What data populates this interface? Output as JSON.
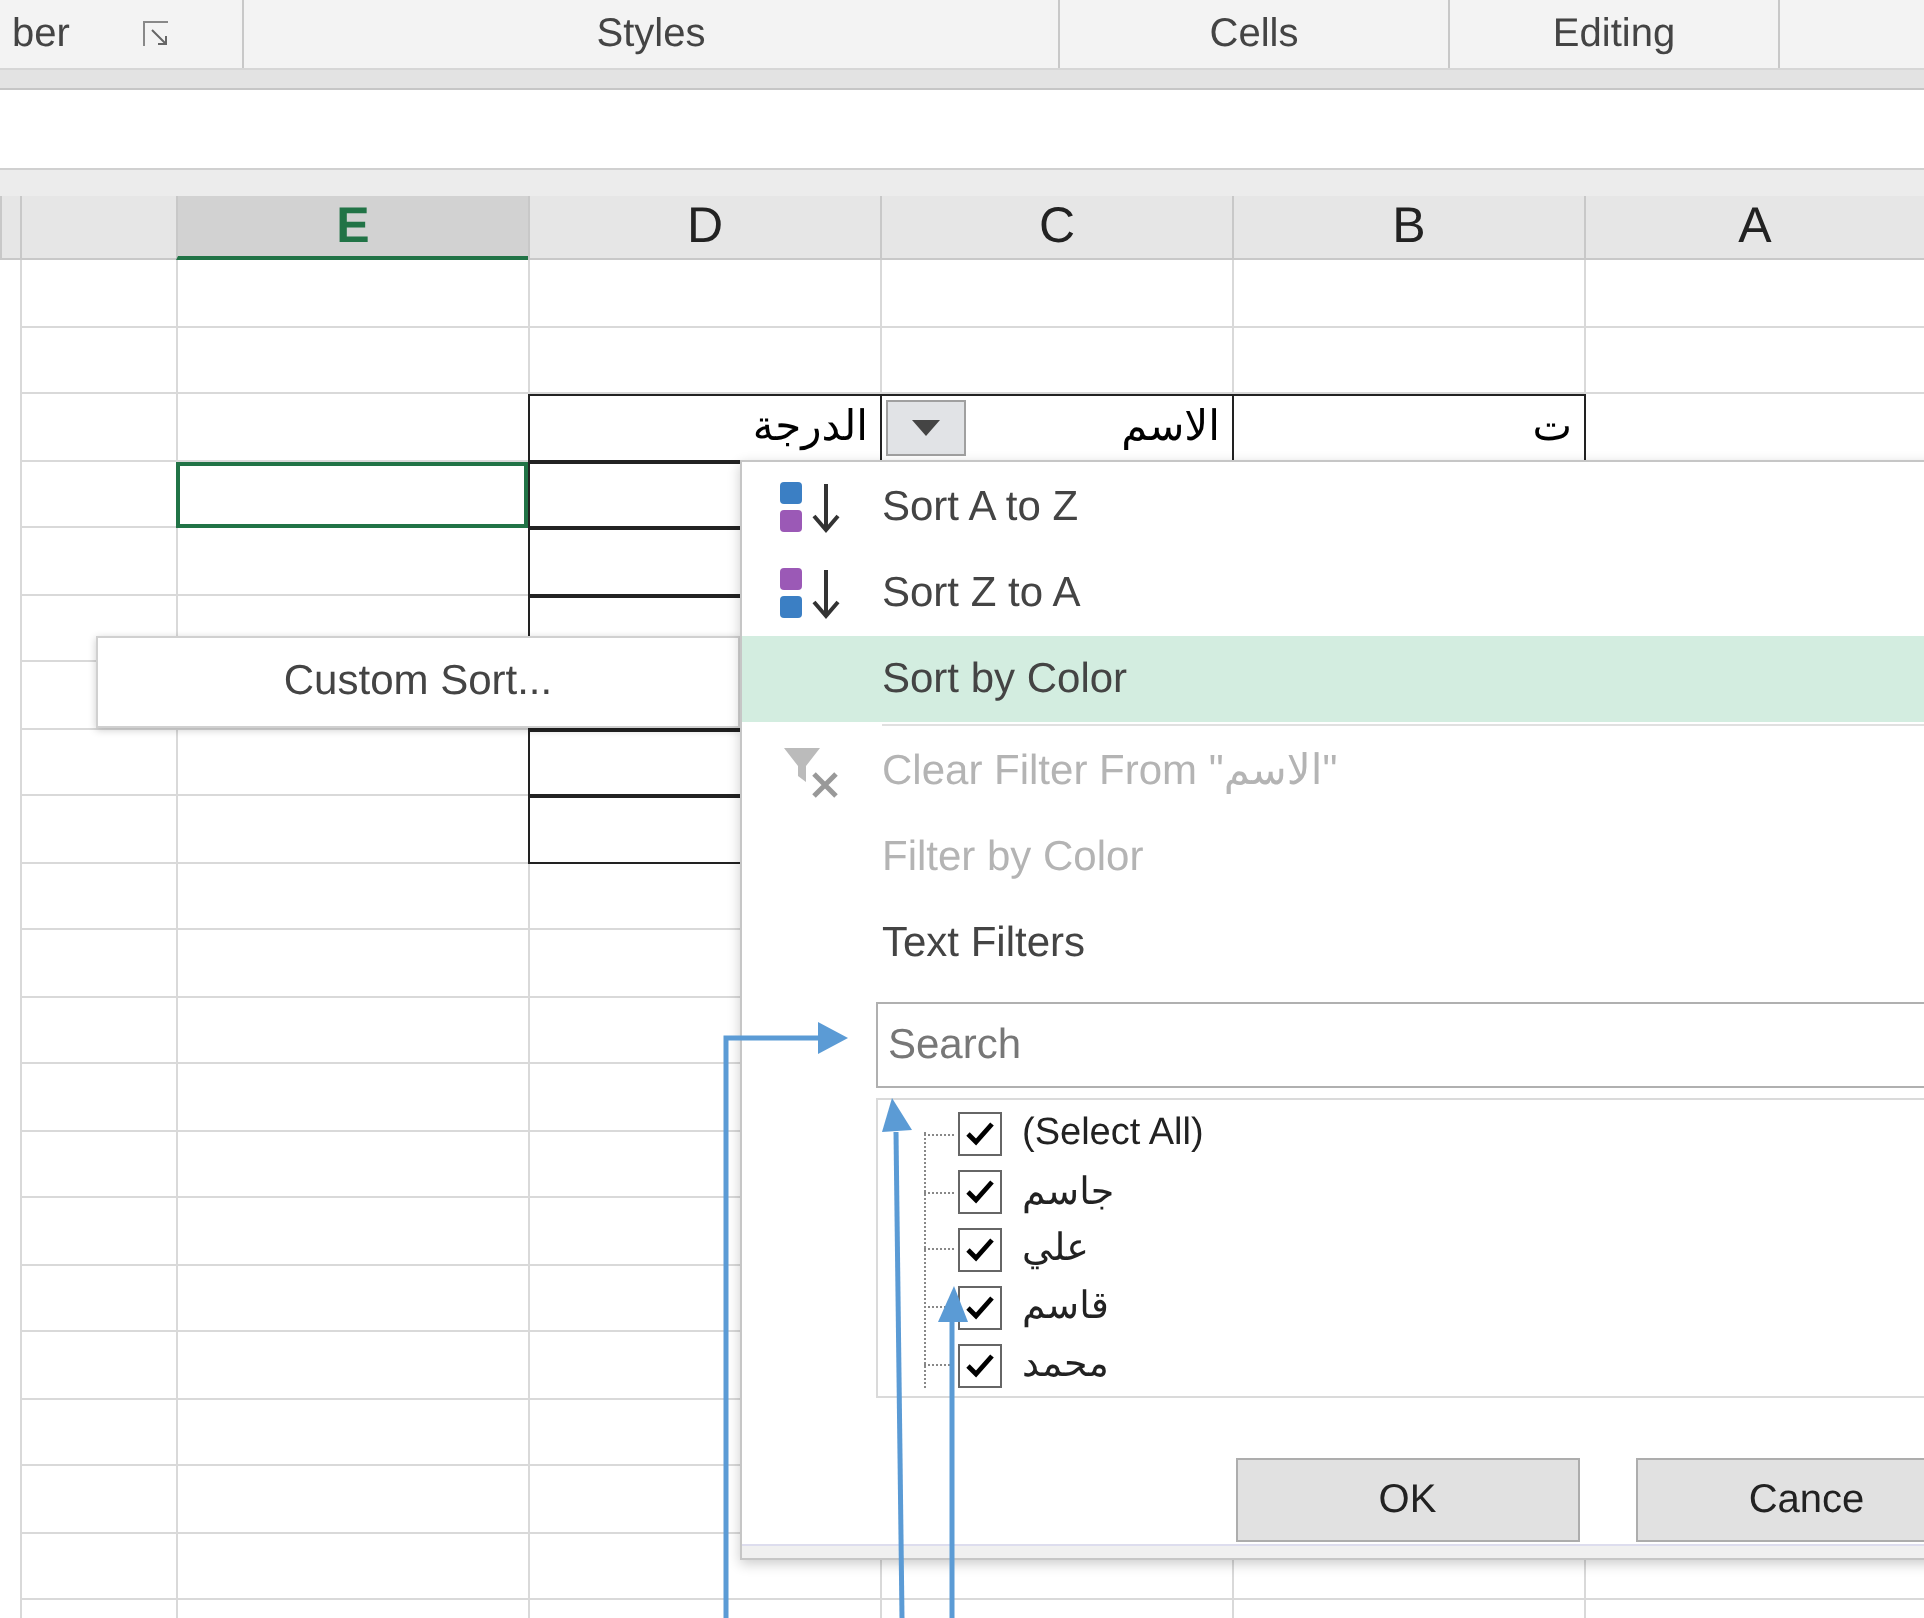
{
  "ribbon": {
    "groups": [
      {
        "label": "Editing",
        "launcher": false
      },
      {
        "label": "Cells",
        "launcher": false
      },
      {
        "label": "Styles",
        "launcher": false
      },
      {
        "label": "ber",
        "launcher": true
      }
    ]
  },
  "columns": [
    {
      "label": "A",
      "selected": false
    },
    {
      "label": "B",
      "selected": false
    },
    {
      "label": "C",
      "selected": false
    },
    {
      "label": "D",
      "selected": false
    },
    {
      "label": "E",
      "selected": true
    }
  ],
  "table": {
    "headers": [
      {
        "text": "ت",
        "filter": false
      },
      {
        "text": "الاسم",
        "filter": true
      },
      {
        "text": "الدرجة",
        "filter": false
      }
    ]
  },
  "submenu": {
    "label": "Custom Sort..."
  },
  "menu": {
    "items": [
      {
        "kind": "sort_asc",
        "label": "Sort A to Z",
        "disabled": false,
        "selected": false
      },
      {
        "kind": "sort_desc",
        "label": "Sort Z to A",
        "disabled": false,
        "selected": false
      },
      {
        "kind": "plain",
        "label": "Sort by Color",
        "disabled": false,
        "selected": true
      },
      {
        "kind": "separator"
      },
      {
        "kind": "clear_filter",
        "label": "Clear Filter From \"الاسم\"",
        "disabled": true,
        "selected": false
      },
      {
        "kind": "plain",
        "label": "Filter by Color",
        "disabled": true,
        "selected": false
      },
      {
        "kind": "plain",
        "label": "Text Filters",
        "disabled": false,
        "selected": false
      }
    ],
    "search": {
      "placeholder": "Search"
    },
    "values": [
      {
        "label": "(Select All)",
        "checked": true
      },
      {
        "label": "جاسم",
        "checked": true
      },
      {
        "label": "علي",
        "checked": true
      },
      {
        "label": "قاسم",
        "checked": true
      },
      {
        "label": "محمد",
        "checked": true
      }
    ],
    "buttons": [
      "Cance",
      "OK"
    ]
  }
}
